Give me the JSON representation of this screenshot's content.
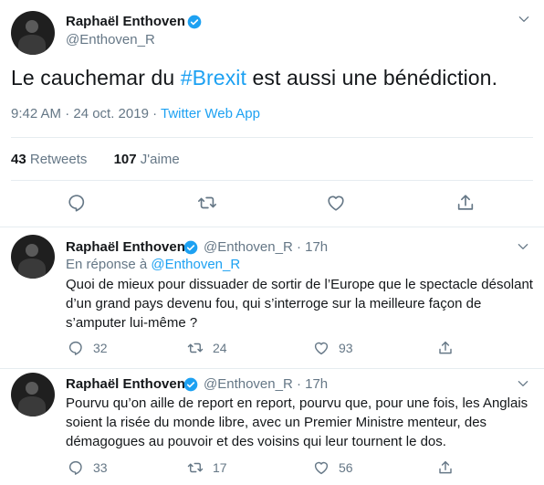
{
  "main_tweet": {
    "author_name": "Raphaël Enthoven",
    "handle": "@Enthoven_R",
    "text_before": "Le cauchemar du ",
    "hashtag": "#Brexit",
    "text_after": " est aussi une bénédiction.",
    "time": "9:42 AM · 24 oct. 2019 · ",
    "app": "Twitter Web App",
    "retweets_count": "43",
    "retweets_label": "Retweets",
    "likes_count": "107",
    "likes_label": "J'aime"
  },
  "replies": [
    {
      "author_name": "Raphaël Enthoven",
      "handle_time": "@Enthoven_R · 17h",
      "in_reply_prefix": "En réponse à ",
      "in_reply_handle": "@Enthoven_R",
      "text": "Quoi de mieux pour dissuader de sortir de l’Europe que le spectacle désolant d’un grand pays devenu fou, qui s’interroge sur la meilleure façon de s’amputer lui-même ?",
      "reply_count": "32",
      "retweet_count": "24",
      "like_count": "93"
    },
    {
      "author_name": "Raphaël Enthoven",
      "handle_time": "@Enthoven_R · 17h",
      "text": "Pourvu qu’on aille de report en report, pourvu que, pour une fois, les Anglais soient la risée du monde libre, avec un Premier Ministre menteur, des démagogues au pouvoir et des voisins qui leur tournent le dos.",
      "reply_count": "33",
      "retweet_count": "17",
      "like_count": "56"
    }
  ],
  "icons": {
    "verified": "verified-badge-icon",
    "more": "chevron-down-icon",
    "reply": "reply-icon",
    "retweet": "retweet-icon",
    "like": "heart-icon",
    "share": "share-icon"
  },
  "colors": {
    "accent": "#1da1f2",
    "secondary_text": "#657786",
    "primary_text": "#14171a",
    "divider": "#e6ecf0"
  }
}
